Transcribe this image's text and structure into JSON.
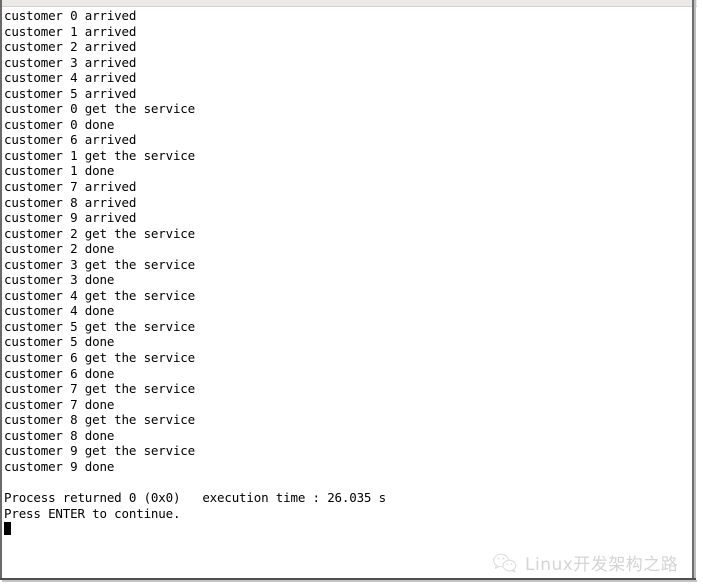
{
  "window": {
    "type": "console-window",
    "background_color": "#ffffff",
    "text_color": "#000000",
    "border_color": "#6a6a6a",
    "titlebar_color": "#eceae6"
  },
  "console": {
    "lines": [
      "customer 0 arrived",
      "customer 1 arrived",
      "customer 2 arrived",
      "customer 3 arrived",
      "customer 4 arrived",
      "customer 5 arrived",
      "customer 0 get the service",
      "customer 0 done",
      "customer 6 arrived",
      "customer 1 get the service",
      "customer 1 done",
      "customer 7 arrived",
      "customer 8 arrived",
      "customer 9 arrived",
      "customer 2 get the service",
      "customer 2 done",
      "customer 3 get the service",
      "customer 3 done",
      "customer 4 get the service",
      "customer 4 done",
      "customer 5 get the service",
      "customer 5 done",
      "customer 6 get the service",
      "customer 6 done",
      "customer 7 get the service",
      "customer 7 done",
      "customer 8 get the service",
      "customer 8 done",
      "customer 9 get the service",
      "customer 9 done",
      "",
      "Process returned 0 (0x0)   execution time : 26.035 s",
      "Press ENTER to continue."
    ],
    "status": {
      "process_returned_label": "Process returned",
      "return_code": "0",
      "return_code_hex": "(0x0)",
      "execution_time_label": "execution time :",
      "execution_time_value": "26.035 s",
      "prompt": "Press ENTER to continue."
    },
    "cursor": {
      "name": "block-cursor",
      "visible": true,
      "color": "#000000"
    }
  },
  "watermark": {
    "logo_name": "wechat-logo",
    "text": "Linux开发架构之路",
    "color": "#d4d4d4"
  }
}
